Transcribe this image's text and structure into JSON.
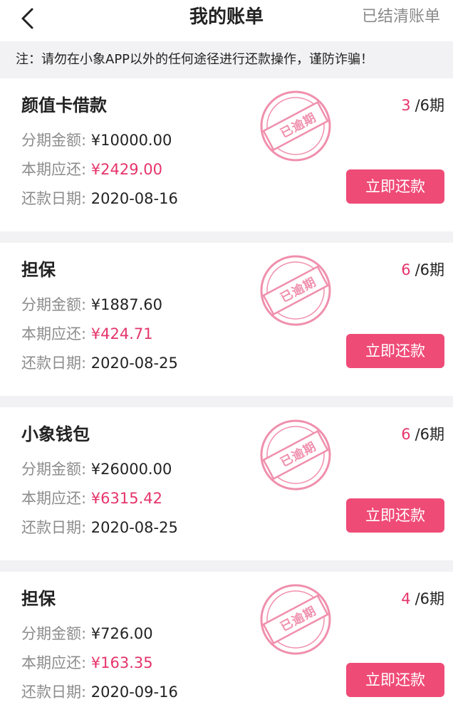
{
  "header": {
    "title": "我的账单",
    "cleared_link": "已结清账单"
  },
  "notice": "注：请勿在小象APP以外的任何途径进行还款操作，谨防诈骗！",
  "labels": {
    "amount": "分期金额: ",
    "due": "本期应还: ",
    "date": "还款日期: ",
    "pay_button": "立即还款",
    "stamp": "已逾期"
  },
  "colors": {
    "accent": "#e5346b",
    "button": "#ef4b77",
    "gap": "#f2f2f4"
  },
  "bills": [
    {
      "name": "颜值卡借款",
      "amount": "¥10000.00",
      "due": "¥2429.00",
      "date": "2020-08-16",
      "current": "3",
      "total": "/6期"
    },
    {
      "name": "担保",
      "amount": "¥1887.60",
      "due": "¥424.71",
      "date": "2020-08-25",
      "current": "6",
      "total": "/6期"
    },
    {
      "name": "小象钱包",
      "amount": "¥26000.00",
      "due": "¥6315.42",
      "date": "2020-08-25",
      "current": "6",
      "total": "/6期"
    },
    {
      "name": "担保",
      "amount": "¥726.00",
      "due": "¥163.35",
      "date": "2020-09-16",
      "current": "4",
      "total": "/6期"
    }
  ]
}
